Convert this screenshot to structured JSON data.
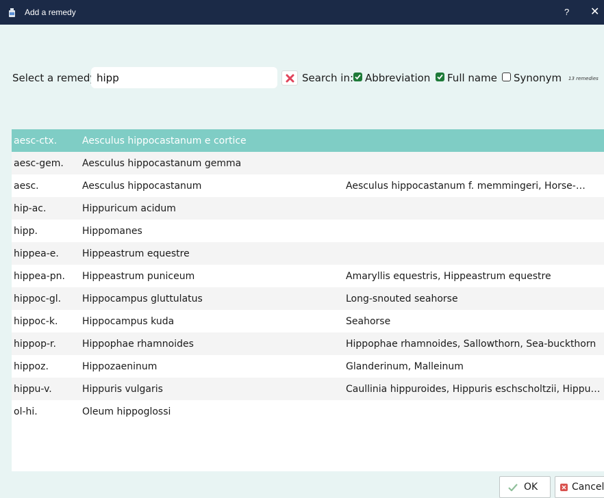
{
  "window": {
    "title": "Add a remedy",
    "help_glyph": "?",
    "close_glyph": "✕",
    "icon": "bottle-icon"
  },
  "search": {
    "label": "Select a remedy",
    "value": "hipp",
    "clear_icon": "clear-icon",
    "search_in_label": "Search in:",
    "options": [
      {
        "label": "Abbreviation",
        "checked": true
      },
      {
        "label": "Full name",
        "checked": true
      },
      {
        "label": "Synonym",
        "checked": false
      }
    ],
    "count": "13 remedies"
  },
  "results": {
    "selected_color": "#7fcdc5",
    "rows": [
      {
        "abbr": "aesc-ctx.",
        "name": "Aesculus hippocastanum e cortice",
        "synonyms": "",
        "selected": true
      },
      {
        "abbr": "aesc-gem.",
        "name": "Aesculus hippocastanum gemma",
        "synonyms": ""
      },
      {
        "abbr": "aesc.",
        "name": "Aesculus hippocastanum",
        "synonyms": "Aesculus hippocastanum f. memmingeri, Horse-…"
      },
      {
        "abbr": "hip-ac.",
        "name": "Hippuricum acidum",
        "synonyms": ""
      },
      {
        "abbr": "hipp.",
        "name": "Hippomanes",
        "synonyms": ""
      },
      {
        "abbr": "hippea-e.",
        "name": "Hippeastrum equestre",
        "synonyms": ""
      },
      {
        "abbr": "hippea-pn.",
        "name": "Hippeastrum puniceum",
        "synonyms": "Amaryllis equestris, Hippeastrum equestre"
      },
      {
        "abbr": "hippoc-gl.",
        "name": "Hippocampus gluttulatus",
        "synonyms": "Long-snouted seahorse"
      },
      {
        "abbr": "hippoc-k.",
        "name": "Hippocampus kuda",
        "synonyms": "Seahorse"
      },
      {
        "abbr": "hippop-r.",
        "name": "Hippophae rhamnoides",
        "synonyms": "Hippophae rhamnoides, Sallowthorn, Sea-buckthorn"
      },
      {
        "abbr": "hippoz.",
        "name": "Hippozaeninum",
        "synonyms": "Glanderinum, Malleinum"
      },
      {
        "abbr": "hippu-v.",
        "name": "Hippuris vulgaris",
        "synonyms": "Caullinia hippuroides, Hippuris eschscholtzii, Hippu…"
      },
      {
        "abbr": "ol-hi.",
        "name": "Oleum hippoglossi",
        "synonyms": ""
      }
    ]
  },
  "footer": {
    "ok_label": "OK",
    "ok_icon": "check-icon",
    "cancel_label": "Cancel",
    "cancel_icon": "cancel-icon"
  }
}
